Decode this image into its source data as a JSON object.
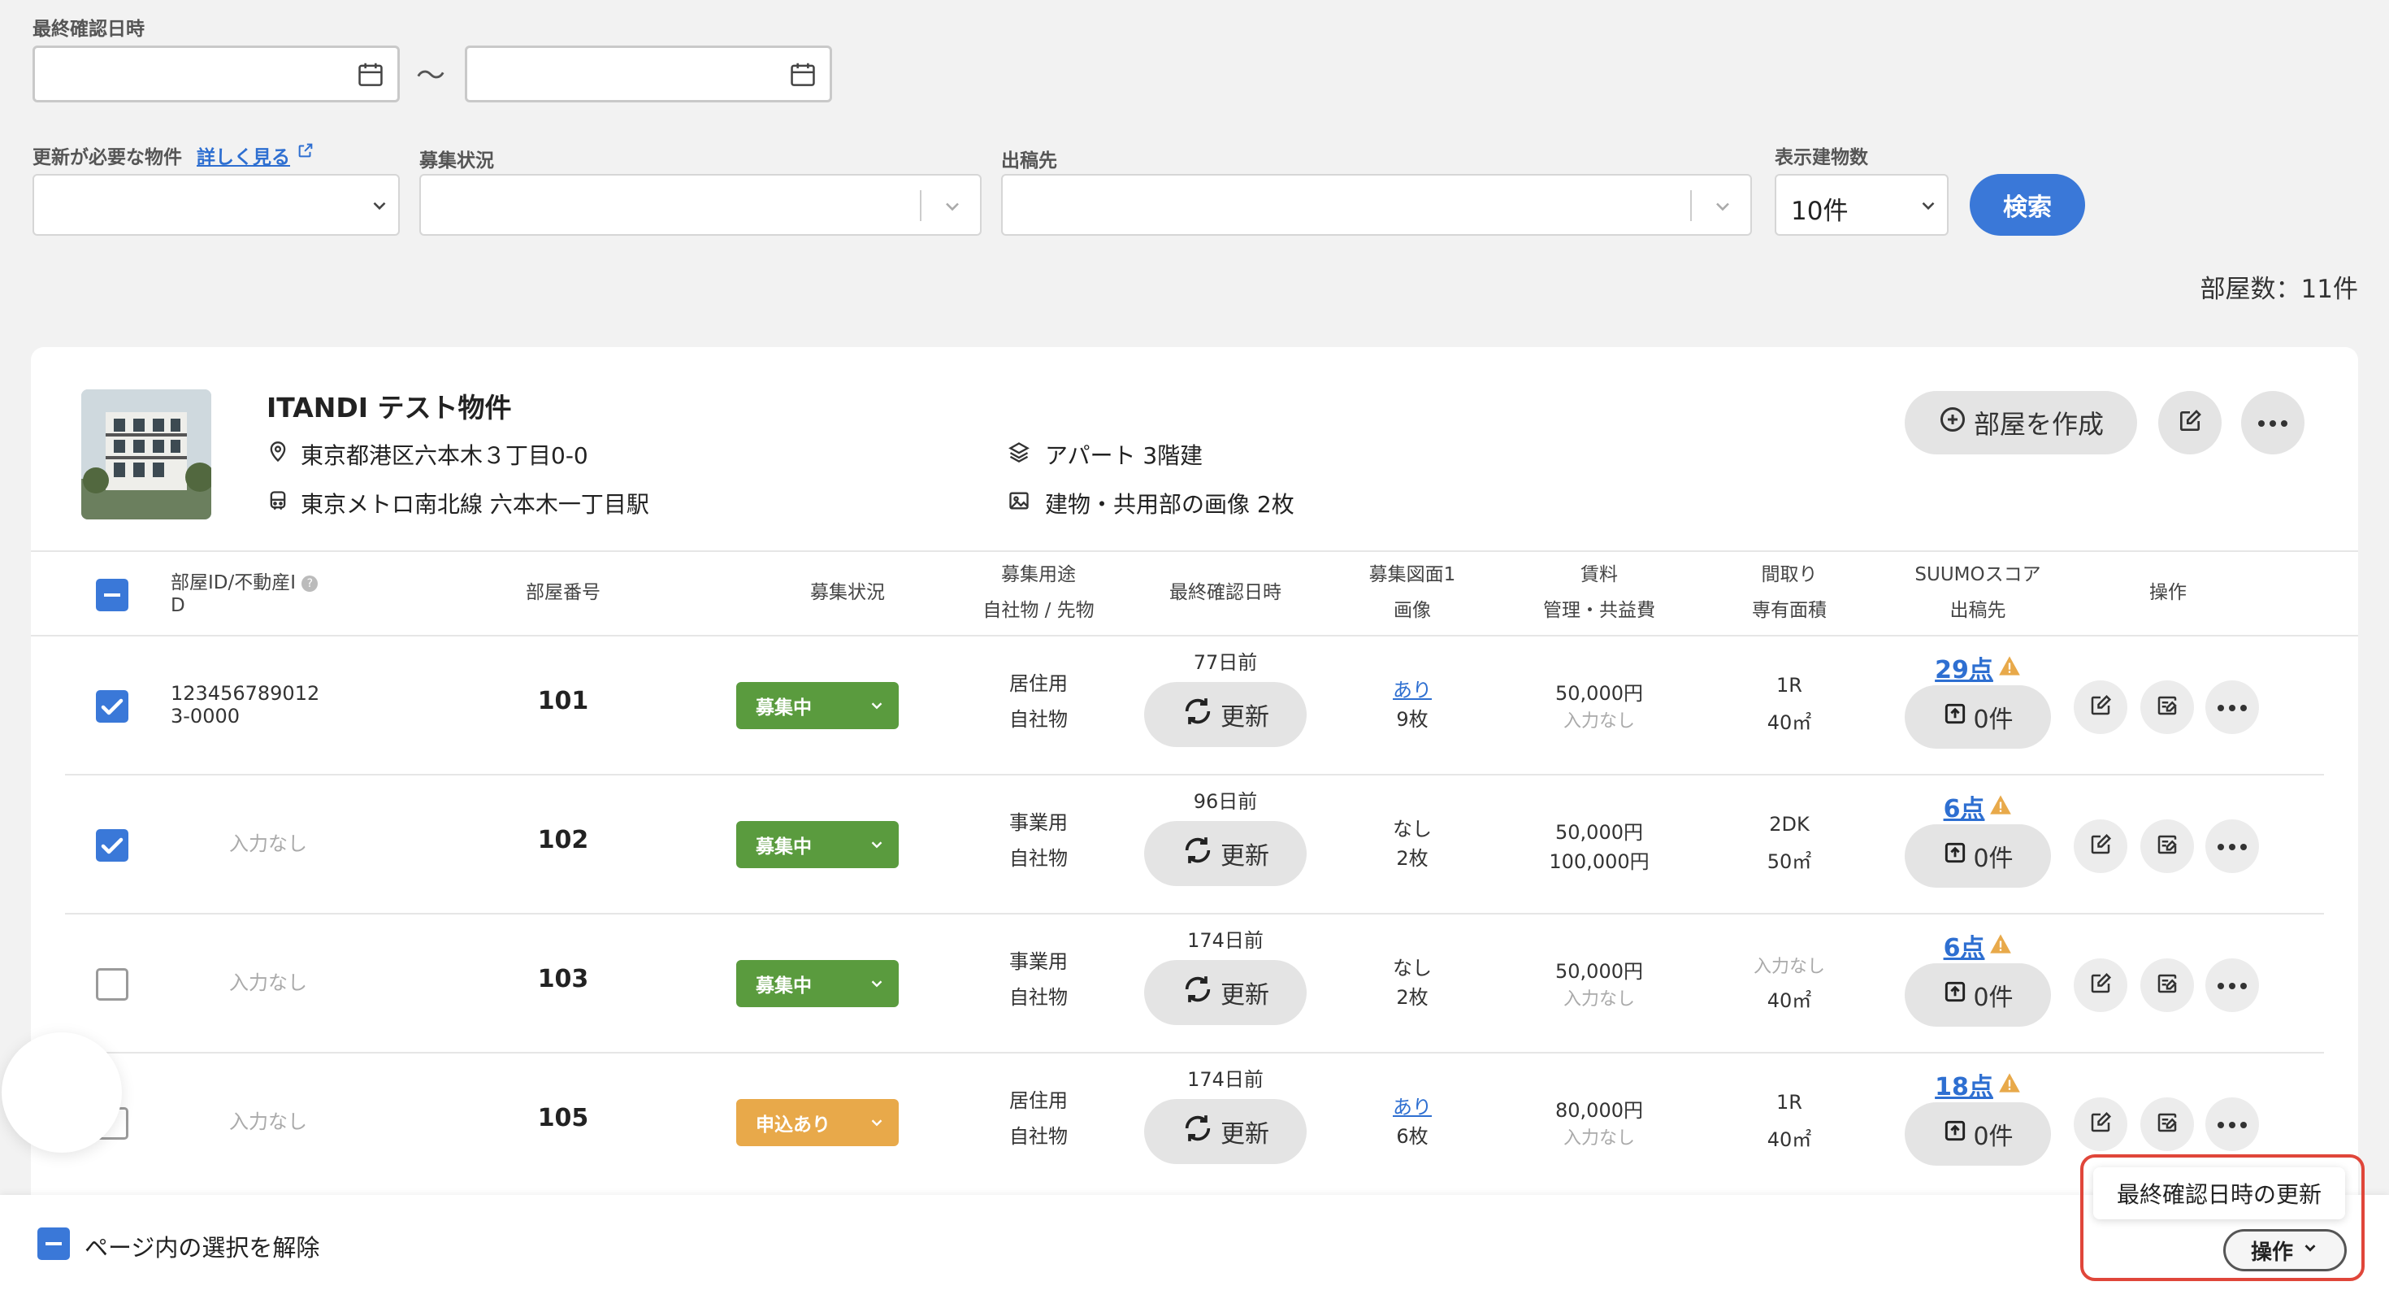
{
  "filters": {
    "last_confirmed_label": "最終確認日時",
    "date_sep": "〜",
    "needs_update_label": "更新が必要な物件",
    "details_link": "詳しく見る",
    "recruit_status_label": "募集状況",
    "publish_label": "出稿先",
    "display_count_label": "表示建物数",
    "display_count_value": "10件",
    "search_button": "検索"
  },
  "room_count": "部屋数：11件",
  "property": {
    "name": "ITANDI テスト物件",
    "address": "東京都港区六本木３丁目0-0",
    "station": "東京メトロ南北線 六本木一丁目駅",
    "type": "アパート 3階建",
    "images": "建物・共用部の画像 2枚",
    "create_room_button": "部屋を作成"
  },
  "table": {
    "headers": {
      "room_id_1": "部屋ID/不動産I",
      "room_id_2": "D",
      "room_number": "部屋番号",
      "recruit_status": "募集状況",
      "purpose_1": "募集用途",
      "purpose_2": "自社物 / 先物",
      "last_confirmed": "最終確認日時",
      "floorplan_1": "募集図面1",
      "floorplan_2": "画像",
      "rent_1": "賃料",
      "rent_2": "管理・共益費",
      "layout_1": "間取り",
      "layout_2": "専有面積",
      "suumo_1": "SUUMOスコア",
      "suumo_2": "出稿先",
      "ops": "操作"
    },
    "rows": [
      {
        "id_line1": "123456789012",
        "id_line2": "3-0000",
        "room": "101",
        "status": "募集中",
        "purpose": "居住用",
        "ownership": "自社物",
        "days": "77日前",
        "update": "更新",
        "floor": "あり",
        "floor_link": true,
        "images": "9枚",
        "rent": "50,000円",
        "fee": "入力なし",
        "fee_muted": true,
        "layout": "1R",
        "layout_muted": false,
        "area": "40㎡",
        "score": "29点",
        "posts": "0件",
        "checked": true
      },
      {
        "id_line1": "入力なし",
        "id_line2": "",
        "room": "102",
        "status": "募集中",
        "purpose": "事業用",
        "ownership": "自社物",
        "days": "96日前",
        "update": "更新",
        "floor": "なし",
        "floor_link": false,
        "images": "2枚",
        "rent": "50,000円",
        "fee": "100,000円",
        "fee_muted": false,
        "layout": "2DK",
        "layout_muted": false,
        "area": "50㎡",
        "score": "6点",
        "posts": "0件",
        "checked": true
      },
      {
        "id_line1": "入力なし",
        "id_line2": "",
        "room": "103",
        "status": "募集中",
        "purpose": "事業用",
        "ownership": "自社物",
        "days": "174日前",
        "update": "更新",
        "floor": "なし",
        "floor_link": false,
        "images": "2枚",
        "rent": "50,000円",
        "fee": "入力なし",
        "fee_muted": true,
        "layout": "入力なし",
        "layout_muted": true,
        "area": "40㎡",
        "score": "6点",
        "posts": "0件",
        "checked": false
      },
      {
        "id_line1": "入力なし",
        "id_line2": "",
        "room": "105",
        "status": "申込あり",
        "purpose": "居住用",
        "ownership": "自社物",
        "days": "174日前",
        "update": "更新",
        "floor": "あり",
        "floor_link": true,
        "images": "6枚",
        "rent": "80,000円",
        "fee": "入力なし",
        "fee_muted": true,
        "layout": "1R",
        "layout_muted": false,
        "area": "40㎡",
        "score": "18点",
        "posts": "0件",
        "checked": false
      }
    ]
  },
  "footer": {
    "deselect": "ページ内の選択を解除",
    "menu_item": "最終確認日時の更新",
    "ops_button": "操作"
  },
  "colors": {
    "accent": "#3a78d8",
    "recruiting": "#5a9b3e",
    "applied": "#e8a94a",
    "highlight": "#e0463a"
  }
}
